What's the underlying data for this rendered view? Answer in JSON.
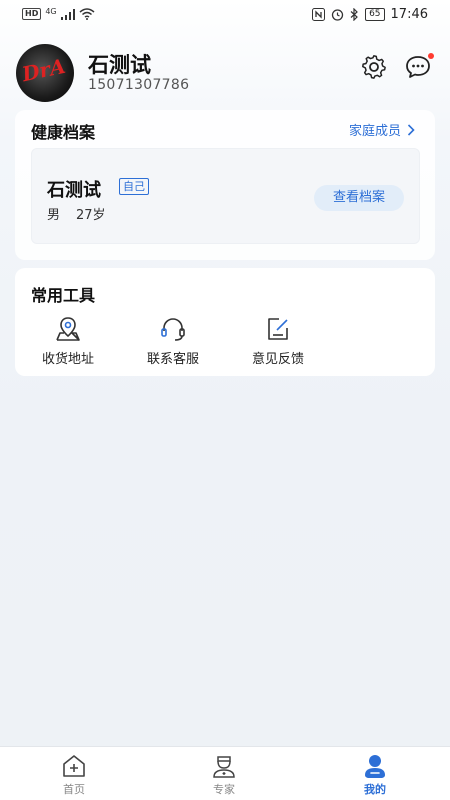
{
  "status_bar": {
    "hd": "HD",
    "network": "4G",
    "battery": "65",
    "time": "17:46"
  },
  "profile": {
    "name": "石测试",
    "phone": "15071307786"
  },
  "health": {
    "title": "健康档案",
    "family_link": "家庭成员",
    "member": {
      "name": "石测试",
      "tag": "自己",
      "gender": "男",
      "age": "27岁",
      "view_button": "查看档案"
    }
  },
  "tools": {
    "title": "常用工具",
    "items": [
      {
        "label": "收货地址",
        "icon": "location-icon"
      },
      {
        "label": "联系客服",
        "icon": "headset-icon"
      },
      {
        "label": "意见反馈",
        "icon": "feedback-icon"
      }
    ]
  },
  "nav": {
    "items": [
      {
        "label": "首页",
        "icon": "home-icon",
        "active": false
      },
      {
        "label": "专家",
        "icon": "doctor-icon",
        "active": false
      },
      {
        "label": "我的",
        "icon": "profile-icon",
        "active": true
      }
    ]
  },
  "colors": {
    "accent": "#2d6fd6",
    "badge": "#ff3b30"
  }
}
